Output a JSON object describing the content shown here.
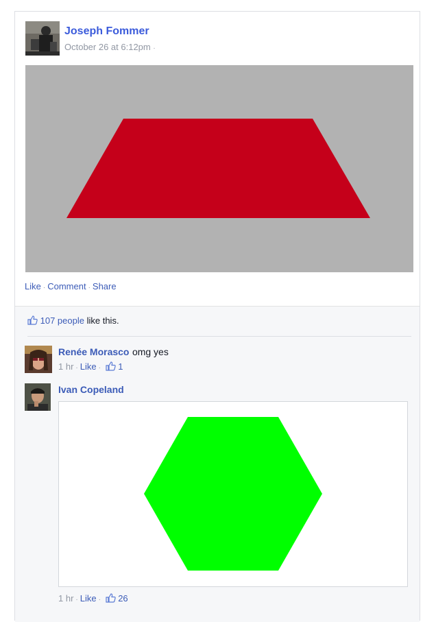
{
  "post": {
    "author": "Joseph Fommer",
    "timestamp": "October 26 at 6:12pm",
    "timestamp_sep": "·",
    "actions": {
      "like": "Like",
      "comment": "Comment",
      "share": "Share",
      "sep": "·"
    },
    "image": {
      "background": "#b2b2b2",
      "shape": "trapezoid",
      "shape_color": "#c5001a"
    }
  },
  "feedback": {
    "likes_count": "107 people",
    "likes_suffix": "like this.",
    "comments": [
      {
        "author": "Renée Morasco",
        "text": "omg yes",
        "time": "1 hr",
        "like_label": "Like",
        "likes": "1"
      },
      {
        "author": "Ivan Copeland",
        "time": "1 hr",
        "like_label": "Like",
        "likes": "26",
        "image": {
          "background": "#ffffff",
          "shape": "hexagon",
          "shape_color": "#00ff00"
        }
      }
    ]
  },
  "colors": {
    "link": "#3b5bb7",
    "meta": "#9197a3",
    "feedback_bg": "#f6f7f9"
  }
}
